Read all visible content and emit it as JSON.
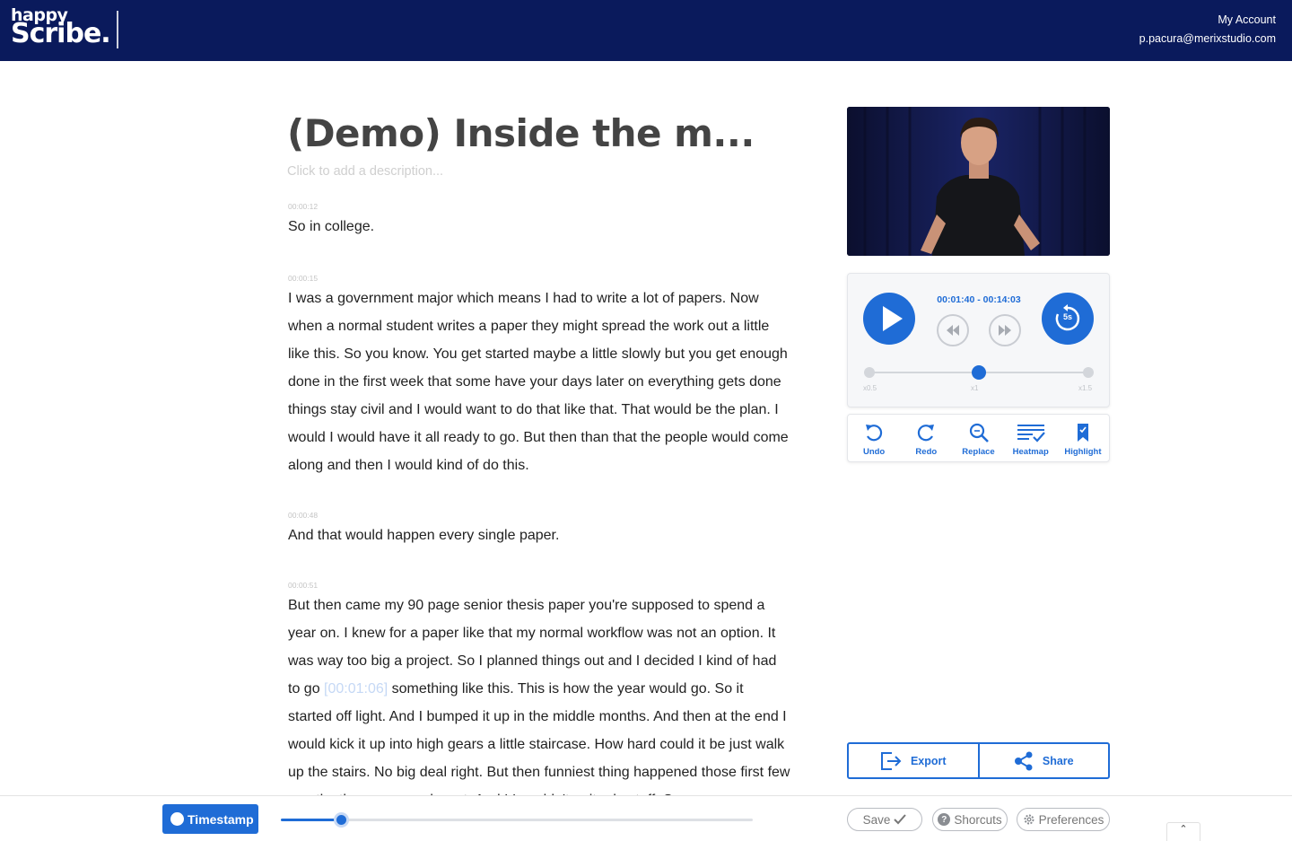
{
  "header": {
    "logo_line1": "happy",
    "logo_line2": "Scribe.",
    "account_label": "My Account",
    "account_email": "p.pacura@merixstudio.com",
    "bg_color": "#0a1a5c"
  },
  "document": {
    "title": "(Demo) Inside the m...",
    "description_placeholder": "Click to add a description..."
  },
  "transcript": {
    "paragraphs": [
      {
        "timestamp": "00:00:12",
        "text": "So in college."
      },
      {
        "timestamp": "00:00:15",
        "text": "I was a government major which means I had to write a lot of papers. Now when a normal student writes a paper they might spread the work out a little like this. So you know. You get started maybe a little slowly but you get enough done in the first week that some have your days later on everything gets done things stay civil and I would want to do that like that. That would be the plan. I would I would have it all ready to go. But then than that the people would come along and then I would kind of do this."
      },
      {
        "timestamp": "00:00:48",
        "text": "And that would happen every single paper."
      },
      {
        "timestamp": "00:00:51",
        "text_before": "But then came my 90 page senior thesis paper you're supposed to spend a year on. I knew for a paper like that my normal workflow was not an option. It was way too big a project. So I planned things out and I decided I kind of had to go ",
        "inline_timestamp": "[00:01:06]",
        "text_after": " something like this. This is how the year would go. So it started off light. And I bumped it up in the middle months. And then at the end I would kick it up into high gears a little staircase. How hard could it be just walk up the stairs. No big deal right. But then funniest thing happened those first few months they came and went. And I I couldn't quite do stuff. So"
      }
    ]
  },
  "player": {
    "time_range": "00:01:40 - 00:14:03",
    "skip_label": "5s",
    "speed_labels": [
      "x0.5",
      "x1",
      "x1.5"
    ],
    "speed_value": "x1",
    "accent_color": "#1f6cd6"
  },
  "tools": {
    "undo": "Undo",
    "redo": "Redo",
    "replace": "Replace",
    "heatmap": "Heatmap",
    "highlight": "Highlight"
  },
  "actions": {
    "export": "Export",
    "share": "Share"
  },
  "bottom_bar": {
    "timestamp_label": "Timestamp",
    "progress_fraction": 0.127,
    "save_label": "Save",
    "shortcuts_label": "Shorcuts",
    "preferences_label": "Preferences"
  }
}
